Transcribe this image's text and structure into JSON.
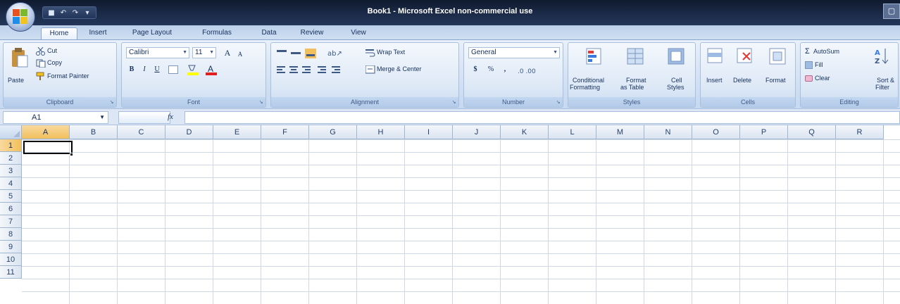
{
  "window": {
    "title": "Book1 - Microsoft Excel non-commercial use",
    "close_glyph": "▢"
  },
  "quick_access": [
    "save-icon",
    "undo-icon",
    "redo-icon",
    "customize-icon"
  ],
  "tabs": [
    "Home",
    "Insert",
    "Page Layout",
    "Formulas",
    "Data",
    "Review",
    "View"
  ],
  "ribbon": {
    "clipboard": {
      "paste": "Paste",
      "cut": "Cut",
      "copy": "Copy",
      "format_painter": "Format Painter",
      "label": "Clipboard"
    },
    "font": {
      "name": "Calibri",
      "size": "11",
      "grow": "A",
      "shrink": "A",
      "bold": "B",
      "italic": "I",
      "underline": "U",
      "label": "Font"
    },
    "alignment": {
      "wrap_text": "Wrap Text",
      "merge_center": "Merge & Center",
      "label": "Alignment"
    },
    "number": {
      "format": "General",
      "currency": "$",
      "percent": "%",
      "comma": ",",
      "label": "Number"
    },
    "styles": {
      "conditional": "Conditional",
      "conditional2": "Formatting",
      "format_table": "Format",
      "format_table2": "as Table",
      "cell_styles": "Cell",
      "cell_styles2": "Styles",
      "label": "Styles"
    },
    "cells": {
      "insert": "Insert",
      "delete": "Delete",
      "format": "Format",
      "label": "Cells"
    },
    "editing": {
      "autosum": "AutoSum",
      "fill": "Fill",
      "clear": "Clear",
      "sort": "Sort &",
      "sort2": "Filter",
      "label": "Editing"
    }
  },
  "formula_bar": {
    "name_box": "A1",
    "fx": "fx",
    "value": ""
  },
  "grid": {
    "columns": [
      "A",
      "B",
      "C",
      "D",
      "E",
      "F",
      "G",
      "H",
      "I",
      "J",
      "K",
      "L",
      "M",
      "N",
      "O",
      "P",
      "Q",
      "R"
    ],
    "rows": [
      "1",
      "2",
      "3",
      "4",
      "5",
      "6",
      "7",
      "8",
      "9",
      "10",
      "11"
    ],
    "active_cell": "A1"
  },
  "colors": {
    "accent": "#f1c05b",
    "ribbon": "#d4e2f4",
    "titlebar": "#1c2c4a"
  }
}
